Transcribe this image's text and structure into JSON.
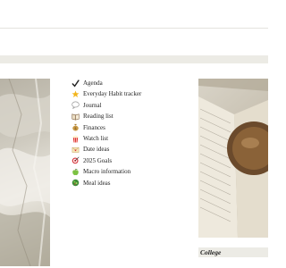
{
  "menu": {
    "items": [
      {
        "label": "Agenda",
        "icon": "check-mark-icon"
      },
      {
        "label": "Everyday Habit tracker",
        "icon": "star-icon"
      },
      {
        "label": "Journal",
        "icon": "speech-bubble-icon"
      },
      {
        "label": "Reading list",
        "icon": "book-icon"
      },
      {
        "label": "Finances",
        "icon": "money-bag-icon"
      },
      {
        "label": "Watch list",
        "icon": "popcorn-icon"
      },
      {
        "label": "Date ideas",
        "icon": "love-letter-icon"
      },
      {
        "label": "2025 Goals",
        "icon": "dart-icon"
      },
      {
        "label": "Macro information",
        "icon": "apple-icon"
      },
      {
        "label": "Meal ideas",
        "icon": "salad-icon"
      }
    ]
  },
  "section": {
    "title": "College"
  },
  "colors": {
    "band": "#ecebe5",
    "text": "#1f1f1f"
  }
}
